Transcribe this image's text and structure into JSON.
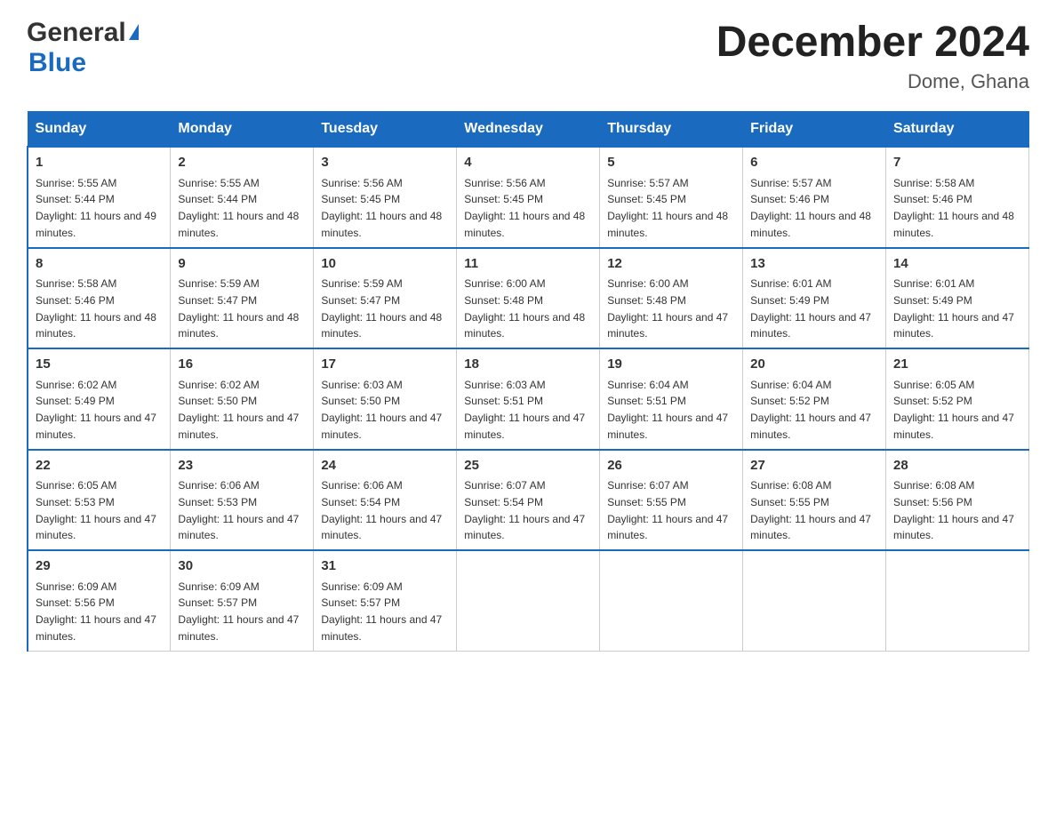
{
  "header": {
    "logo_general": "General",
    "logo_blue": "Blue",
    "title": "December 2024",
    "subtitle": "Dome, Ghana"
  },
  "days_of_week": [
    "Sunday",
    "Monday",
    "Tuesday",
    "Wednesday",
    "Thursday",
    "Friday",
    "Saturday"
  ],
  "weeks": [
    [
      {
        "day": "1",
        "sunrise": "5:55 AM",
        "sunset": "5:44 PM",
        "daylight": "11 hours and 49 minutes."
      },
      {
        "day": "2",
        "sunrise": "5:55 AM",
        "sunset": "5:44 PM",
        "daylight": "11 hours and 48 minutes."
      },
      {
        "day": "3",
        "sunrise": "5:56 AM",
        "sunset": "5:45 PM",
        "daylight": "11 hours and 48 minutes."
      },
      {
        "day": "4",
        "sunrise": "5:56 AM",
        "sunset": "5:45 PM",
        "daylight": "11 hours and 48 minutes."
      },
      {
        "day": "5",
        "sunrise": "5:57 AM",
        "sunset": "5:45 PM",
        "daylight": "11 hours and 48 minutes."
      },
      {
        "day": "6",
        "sunrise": "5:57 AM",
        "sunset": "5:46 PM",
        "daylight": "11 hours and 48 minutes."
      },
      {
        "day": "7",
        "sunrise": "5:58 AM",
        "sunset": "5:46 PM",
        "daylight": "11 hours and 48 minutes."
      }
    ],
    [
      {
        "day": "8",
        "sunrise": "5:58 AM",
        "sunset": "5:46 PM",
        "daylight": "11 hours and 48 minutes."
      },
      {
        "day": "9",
        "sunrise": "5:59 AM",
        "sunset": "5:47 PM",
        "daylight": "11 hours and 48 minutes."
      },
      {
        "day": "10",
        "sunrise": "5:59 AM",
        "sunset": "5:47 PM",
        "daylight": "11 hours and 48 minutes."
      },
      {
        "day": "11",
        "sunrise": "6:00 AM",
        "sunset": "5:48 PM",
        "daylight": "11 hours and 48 minutes."
      },
      {
        "day": "12",
        "sunrise": "6:00 AM",
        "sunset": "5:48 PM",
        "daylight": "11 hours and 47 minutes."
      },
      {
        "day": "13",
        "sunrise": "6:01 AM",
        "sunset": "5:49 PM",
        "daylight": "11 hours and 47 minutes."
      },
      {
        "day": "14",
        "sunrise": "6:01 AM",
        "sunset": "5:49 PM",
        "daylight": "11 hours and 47 minutes."
      }
    ],
    [
      {
        "day": "15",
        "sunrise": "6:02 AM",
        "sunset": "5:49 PM",
        "daylight": "11 hours and 47 minutes."
      },
      {
        "day": "16",
        "sunrise": "6:02 AM",
        "sunset": "5:50 PM",
        "daylight": "11 hours and 47 minutes."
      },
      {
        "day": "17",
        "sunrise": "6:03 AM",
        "sunset": "5:50 PM",
        "daylight": "11 hours and 47 minutes."
      },
      {
        "day": "18",
        "sunrise": "6:03 AM",
        "sunset": "5:51 PM",
        "daylight": "11 hours and 47 minutes."
      },
      {
        "day": "19",
        "sunrise": "6:04 AM",
        "sunset": "5:51 PM",
        "daylight": "11 hours and 47 minutes."
      },
      {
        "day": "20",
        "sunrise": "6:04 AM",
        "sunset": "5:52 PM",
        "daylight": "11 hours and 47 minutes."
      },
      {
        "day": "21",
        "sunrise": "6:05 AM",
        "sunset": "5:52 PM",
        "daylight": "11 hours and 47 minutes."
      }
    ],
    [
      {
        "day": "22",
        "sunrise": "6:05 AM",
        "sunset": "5:53 PM",
        "daylight": "11 hours and 47 minutes."
      },
      {
        "day": "23",
        "sunrise": "6:06 AM",
        "sunset": "5:53 PM",
        "daylight": "11 hours and 47 minutes."
      },
      {
        "day": "24",
        "sunrise": "6:06 AM",
        "sunset": "5:54 PM",
        "daylight": "11 hours and 47 minutes."
      },
      {
        "day": "25",
        "sunrise": "6:07 AM",
        "sunset": "5:54 PM",
        "daylight": "11 hours and 47 minutes."
      },
      {
        "day": "26",
        "sunrise": "6:07 AM",
        "sunset": "5:55 PM",
        "daylight": "11 hours and 47 minutes."
      },
      {
        "day": "27",
        "sunrise": "6:08 AM",
        "sunset": "5:55 PM",
        "daylight": "11 hours and 47 minutes."
      },
      {
        "day": "28",
        "sunrise": "6:08 AM",
        "sunset": "5:56 PM",
        "daylight": "11 hours and 47 minutes."
      }
    ],
    [
      {
        "day": "29",
        "sunrise": "6:09 AM",
        "sunset": "5:56 PM",
        "daylight": "11 hours and 47 minutes."
      },
      {
        "day": "30",
        "sunrise": "6:09 AM",
        "sunset": "5:57 PM",
        "daylight": "11 hours and 47 minutes."
      },
      {
        "day": "31",
        "sunrise": "6:09 AM",
        "sunset": "5:57 PM",
        "daylight": "11 hours and 47 minutes."
      },
      null,
      null,
      null,
      null
    ]
  ]
}
